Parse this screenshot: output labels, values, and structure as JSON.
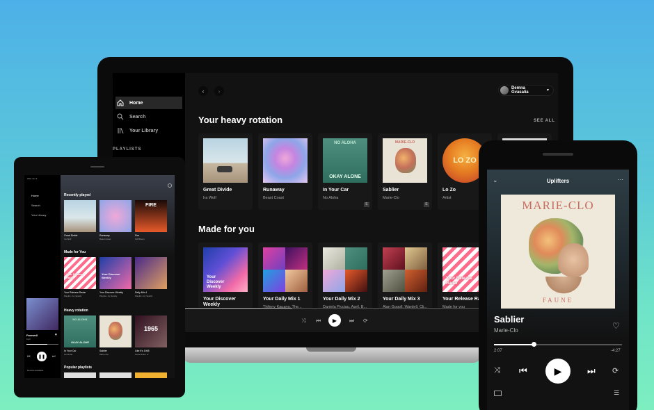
{
  "laptop": {
    "sidebar": {
      "items": [
        {
          "label": "Home",
          "icon": "home-icon"
        },
        {
          "label": "Search",
          "icon": "search-icon"
        },
        {
          "label": "Your Library",
          "icon": "library-icon"
        }
      ],
      "playlists_heading": "PLAYLISTS"
    },
    "user_name": "Demna Gvasalia",
    "heavy_rotation": {
      "title": "Your heavy rotation",
      "see_all": "SEE ALL",
      "cards": [
        {
          "title": "Great Divide",
          "subtitle": "Ira Wolf"
        },
        {
          "title": "Runaway",
          "subtitle": "Beast Coast"
        },
        {
          "title": "In Your Car",
          "subtitle": "No Aloha"
        },
        {
          "title": "Sablier",
          "subtitle": "Marie-Clo"
        },
        {
          "title": "Lo Zo",
          "subtitle": "Artist"
        }
      ]
    },
    "made_for_you": {
      "title": "Made for you",
      "cards": [
        {
          "title": "Your Discover Weekly",
          "subtitle": "",
          "art_text": "Your Discover Weekly"
        },
        {
          "title": "Your Daily Mix 1",
          "subtitle": "Thifeny Kauanq, The..."
        },
        {
          "title": "Your Daily Mix 2",
          "subtitle": "Daniela Picciau, April, B..."
        },
        {
          "title": "Your Daily Mix 3",
          "subtitle": "Alan Gogoll, Wardell, Cli..."
        },
        {
          "title": "Your Release Radar",
          "subtitle": "Made for you",
          "art_text": "Your Release Radar"
        }
      ]
    },
    "badge_text": "E",
    "album_text": {
      "in_your_car": "NO ALOHA",
      "lo_zo": "LO ZO"
    }
  },
  "tablet": {
    "status_time": "Wed Jun 3",
    "nav": [
      "Home",
      "Search",
      "Your Library"
    ],
    "recently_played": {
      "title": "Recently played",
      "items": [
        {
          "title": "Great Divide",
          "subtitle": "Ira Wolf"
        },
        {
          "title": "Runaway",
          "subtitle": "Beast Coast"
        },
        {
          "title": "Fire",
          "subtitle": "Kid Bloom"
        }
      ],
      "fire_text": "FIRE"
    },
    "made_for_you": {
      "title": "Made for You",
      "items": [
        {
          "title": "Your Release Radar",
          "subtitle": "Playlist • by Spotify",
          "art_text": "Your Release Radar"
        },
        {
          "title": "Your Discover Weekly",
          "subtitle": "Playlist • by Spotify",
          "art_text": "Your Discover Weekly"
        },
        {
          "title": "Daily Mix 4",
          "subtitle": "Playlist • by Spotify"
        }
      ]
    },
    "heavy_rotation": {
      "title": "Heavy rotation",
      "items": [
        {
          "title": "In Your Car",
          "subtitle": "No Aloha"
        },
        {
          "title": "Sablier",
          "subtitle": "Marie-Clo"
        },
        {
          "title": "Like It's 1965",
          "subtitle": "Gene Evaro Jr."
        }
      ],
      "okay_alone": "OKAY ALONE",
      "no_aloha": "NO ALOHA",
      "year_text": "1965"
    },
    "popular_playlists": "Popular playlists",
    "now_playing": {
      "title": "Farewell",
      "artist": "Kyril"
    },
    "devices": "Devices available"
  },
  "phone": {
    "header": "Uplifters",
    "album_artist_text": "MARIE-CLO",
    "album_title_text": "FAUNE",
    "song": "Sablier",
    "artist": "Marie-Clo",
    "elapsed": "2:07",
    "remaining": "-4:27",
    "progress": 0.31
  },
  "shared_art_text": {
    "okay_alone": "OKAY ALONE",
    "no_aloha": "NO ALOHA",
    "marie_clo": "MARIE-CLO"
  },
  "colors": {
    "spotify_black": "#121212",
    "sidebar_black": "#000000",
    "card": "#181818",
    "text_muted": "#b3b3b3",
    "accent_green": "#1db954"
  }
}
